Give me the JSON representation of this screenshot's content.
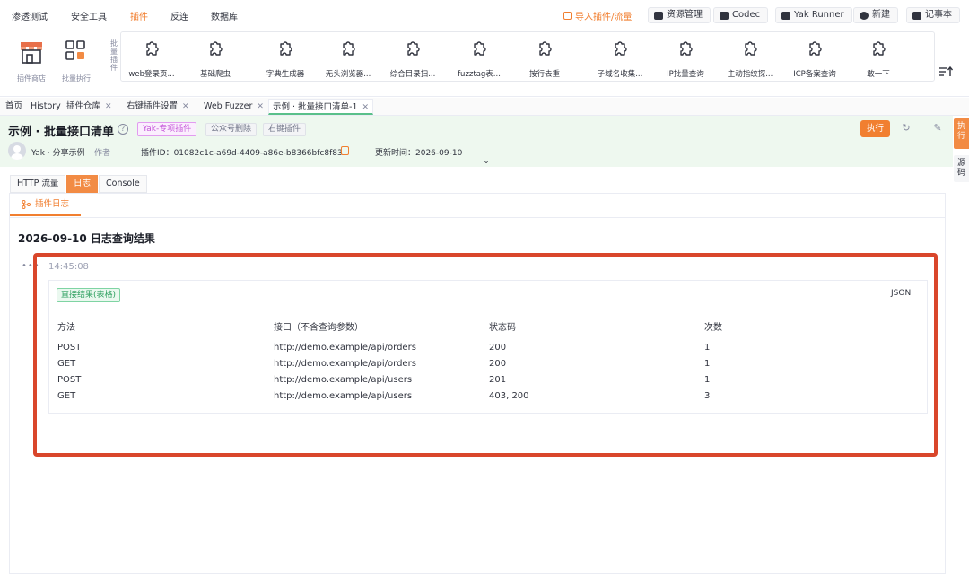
{
  "menu": {
    "items": [
      "渗透测试",
      "安全工具",
      "插件",
      "反连",
      "数据库"
    ],
    "active_index": 2,
    "import_label": "导入插件/流量",
    "right_buttons": [
      "资源管理",
      "Codec",
      "Yak Runner",
      "新建",
      "记事本"
    ]
  },
  "tools": {
    "store_label": "插件商店",
    "batch_label": "批量执行",
    "vertical_label": "批量插件",
    "plugins": [
      "web登录页...",
      "基础爬虫",
      "字典生成器",
      "无头浏览器...",
      "综合目录扫...",
      "fuzztag表...",
      "按行去重",
      "子域名收集...",
      "IP批量查询",
      "主动指纹探...",
      "ICP备案查询",
      "敢一下"
    ]
  },
  "tabs": [
    {
      "label": "首页",
      "closable": false
    },
    {
      "label": "History",
      "closable": false
    },
    {
      "label": "插件仓库",
      "closable": true
    },
    {
      "label": "右键插件设置",
      "closable": true
    },
    {
      "label": "Web Fuzzer",
      "closable": true
    },
    {
      "label": "示例 · 批量接口清单-1",
      "closable": true
    }
  ],
  "header": {
    "title": "示例 · 批量接口清单",
    "badge_type": "Yak-专项插件",
    "badge_public": "公众号删除",
    "badge_right": "右键插件",
    "author_name": "Yak · 分享示例",
    "author_role": "作者",
    "plugin_id": "插件ID：01082c1c-a69d-4409-a86e-b8366bfc8f83",
    "updated": "更新时间：2026-09-10",
    "run_label": "执行"
  },
  "side_tabs": [
    "执行",
    "源码"
  ],
  "subtabs": [
    "HTTP 流量",
    "日志",
    "Console"
  ],
  "active_subtab": 1,
  "inner_tab": "插件日志",
  "log": {
    "heading": "2026-09-10 日志查询结果",
    "dots": "•••",
    "time": "14:45:08",
    "tag": "直接结果(表格)",
    "json_label": "JSON",
    "columns": [
      "方法",
      "接口（不含查询参数）",
      "状态码",
      "次数"
    ],
    "rows": [
      [
        "POST",
        "http://demo.example/api/orders",
        "200",
        "1"
      ],
      [
        "GET",
        "http://demo.example/api/orders",
        "200",
        "1"
      ],
      [
        "POST",
        "http://demo.example/api/users",
        "201",
        "1"
      ],
      [
        "GET",
        "http://demo.example/api/users",
        "403, 200",
        "3"
      ]
    ]
  },
  "colors": {
    "accent": "#f17f30",
    "highlight": "#d9462b",
    "success": "#2fa060"
  }
}
